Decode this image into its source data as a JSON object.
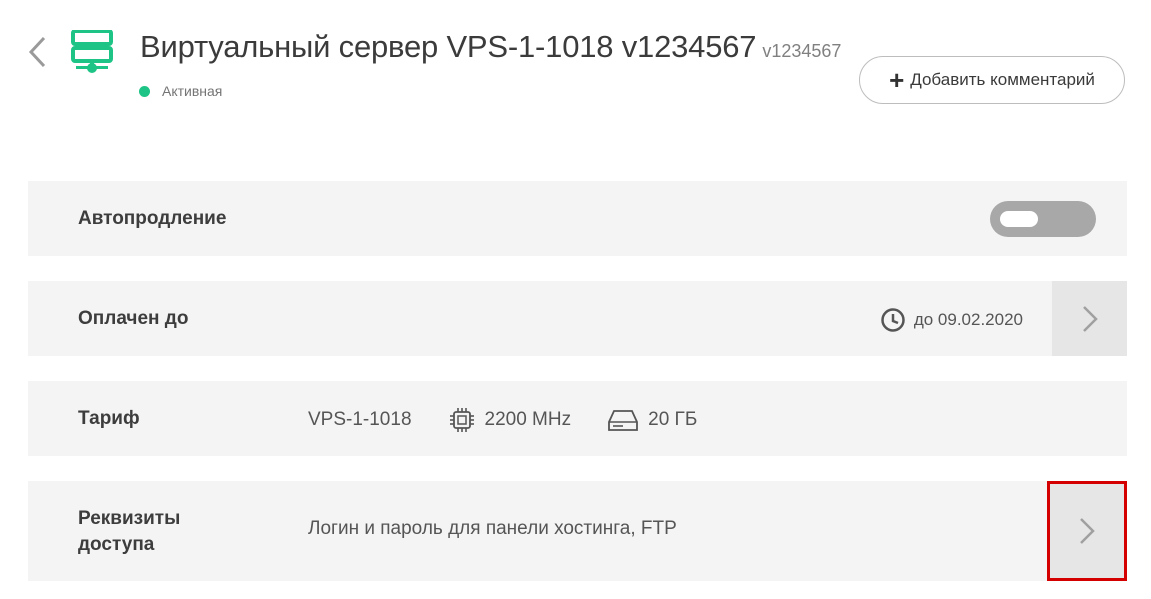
{
  "header": {
    "title": "Виртуальный сервер VPS-1-1018 v1234567",
    "title_sub": "v1234567",
    "status": "Активная",
    "add_comment_label": "Добавить комментарий"
  },
  "rows": {
    "autorenew": {
      "label": "Автопродление",
      "enabled": false
    },
    "paid_until": {
      "label": "Оплачен до",
      "value": "до 09.02.2020"
    },
    "tariff": {
      "label": "Тариф",
      "plan": "VPS-1-1018",
      "cpu": "2200 MHz",
      "disk": "20 ГБ"
    },
    "access": {
      "label_line1": "Реквизиты",
      "label_line2": "доступа",
      "value": "Логин и пароль для панели хостинга, FTP"
    }
  },
  "colors": {
    "accent": "#1ec486",
    "highlight": "#d40000",
    "row_bg": "#f4f4f4"
  },
  "icons": [
    "chevron-left-icon",
    "server-icon",
    "plus-icon",
    "clock-icon",
    "chevron-right-icon",
    "cpu-icon",
    "disk-icon"
  ]
}
